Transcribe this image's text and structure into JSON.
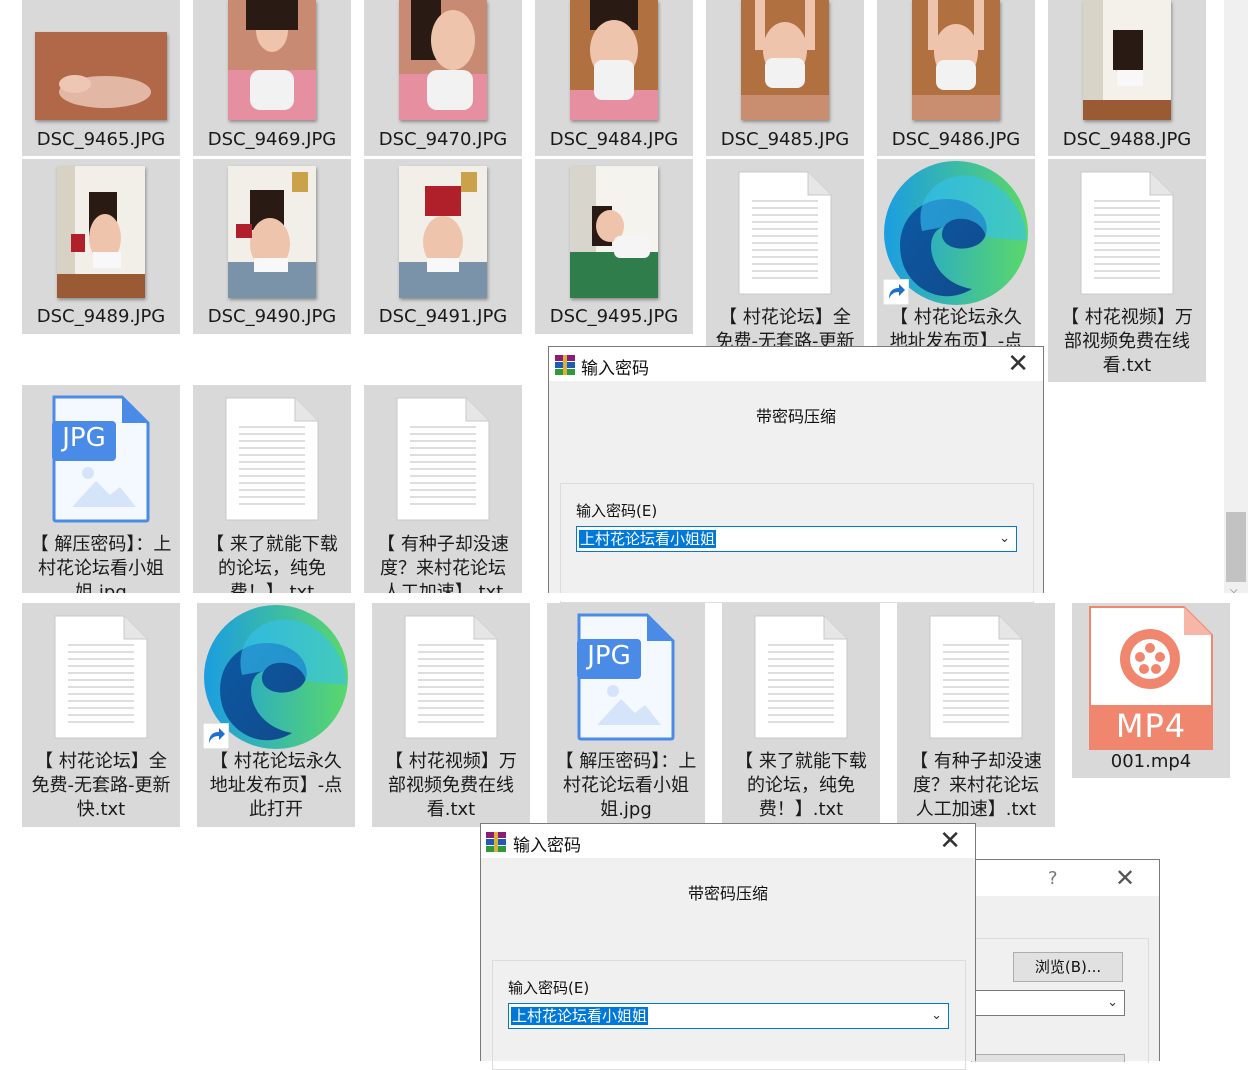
{
  "row1": [
    "DSC_9465.JPG",
    "DSC_9469.JPG",
    "DSC_9470.JPG",
    "DSC_9484.JPG",
    "DSC_9485.JPG",
    "DSC_9486.JPG",
    "DSC_9488.JPG"
  ],
  "row2": [
    "DSC_9489.JPG",
    "DSC_9490.JPG",
    "DSC_9491.JPG",
    "DSC_9495.JPG"
  ],
  "upper_files": {
    "forum_txt": "【 村花论坛】全免费-无套路-更新快.txt",
    "link": "【 村花论坛永久地址发布页】-点此打开",
    "video_txt": "【 村花视频】万部视频免费在线看.txt",
    "jpg": "【 解压密码】：上村花论坛看小姐姐.jpg",
    "download_txt": "【 来了就能下载的论坛，纯免费！】.txt",
    "speed_txt": "【 有种子却没速度？来村花论坛人工加速】.txt"
  },
  "lower_files": {
    "forum_txt": "【 村花论坛】全免费-无套路-更新快.txt",
    "link": "【 村花论坛永久地址发布页】-点此打开",
    "video_txt": "【 村花视频】万部视频免费在线看.txt",
    "jpg": "【 解压密码】：上村花论坛看小姐姐.jpg",
    "download_txt": "【 来了就能下载的论坛，纯免费！】.txt",
    "speed_txt": "【 有种子却没速度？来村花论坛人工加速】.txt",
    "mp4": "001.mp4"
  },
  "icons": {
    "jpg_badge": "JPG",
    "mp4_badge": "MP4"
  },
  "dialog1": {
    "title": "输入密码",
    "subtitle": "带密码压缩",
    "field_label": "输入密码(E)",
    "password": "上村花论坛看小姐姐"
  },
  "dialog2": {
    "title": "输入密码",
    "subtitle": "带密码压缩",
    "field_label": "输入密码(E)",
    "password": "上村花论坛看小姐姐"
  },
  "back_dialog": {
    "help": "?",
    "browse_button": "浏览(B)..."
  },
  "colors": {
    "tile": "#d9d9d9",
    "accent": "#0078d7",
    "mp4": "#f0866e",
    "jpg_icon": "#4a8be8"
  }
}
